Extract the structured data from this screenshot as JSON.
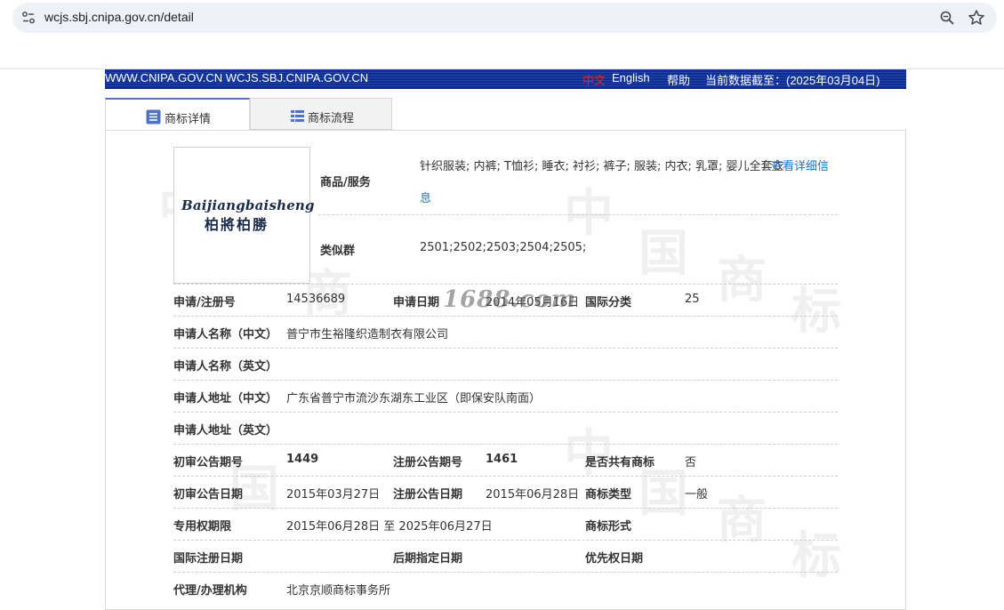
{
  "browser": {
    "url": "wcjs.sbj.cnipa.gov.cn/detail"
  },
  "header": {
    "domains": "WWW.CNIPA.GOV.CN WCJS.SBJ.CNIPA.GOV.CN",
    "lang_cn": "中文",
    "lang_en": "English",
    "help": "帮助",
    "data_date": "当前数据截至：(2025年03月04日)"
  },
  "tabs": [
    {
      "label": "商标详情",
      "icon": "list-icon"
    },
    {
      "label": "商标流程",
      "icon": "grid-list-icon"
    }
  ],
  "watermark": {
    "chars": [
      "中",
      "国",
      "商",
      "标"
    ],
    "site": "1688.com"
  },
  "logo": {
    "text_en": "Baijiangbaisheng",
    "text_cn": "柏將柏勝"
  },
  "goods": {
    "label": "商品/服务",
    "value": "针织服装; 内裤; T恤衫; 睡衣; 衬衫; 裤子; 服装; 内衣; 乳罩; 婴儿全套衣",
    "more_link_1": "查看详细信",
    "more_link_2": "息"
  },
  "similar_group": {
    "label": "类似群",
    "value": "2501;2502;2503;2504;2505;"
  },
  "fields": {
    "reg_no_label": "申请/注册号",
    "reg_no": "14536689",
    "apply_date_label": "申请日期",
    "apply_date": "2014年05月16日",
    "intl_class_label": "国际分类",
    "intl_class": "25",
    "applicant_cn_label": "申请人名称（中文）",
    "applicant_cn": "普宁市生裕隆织造制衣有限公司",
    "applicant_en_label": "申请人名称（英文）",
    "address_cn_label": "申请人地址（中文）",
    "address_cn": "广东省普宁市流沙东湖东工业区（即保安队南面）",
    "address_en_label": "申请人地址（英文）",
    "prelim_no_label": "初审公告期号",
    "prelim_no": "1449",
    "reg_notice_no_label": "注册公告期号",
    "reg_notice_no": "1461",
    "shared_label": "是否共有商标",
    "shared": "否",
    "prelim_date_label": "初审公告日期",
    "prelim_date": "2015年03月27日",
    "reg_notice_date_label": "注册公告日期",
    "reg_notice_date": "2015年06月28日",
    "tm_type_label": "商标类型",
    "tm_type": "一般",
    "exclusive_label": "专用权期限",
    "exclusive": "2015年06月28日 至 2025年06月27日",
    "tm_form_label": "商标形式",
    "intl_reg_date_label": "国际注册日期",
    "later_date_label": "后期指定日期",
    "priority_date_label": "优先权日期",
    "agent_label": "代理/办理机构",
    "agent": "北京京顺商标事务所"
  }
}
